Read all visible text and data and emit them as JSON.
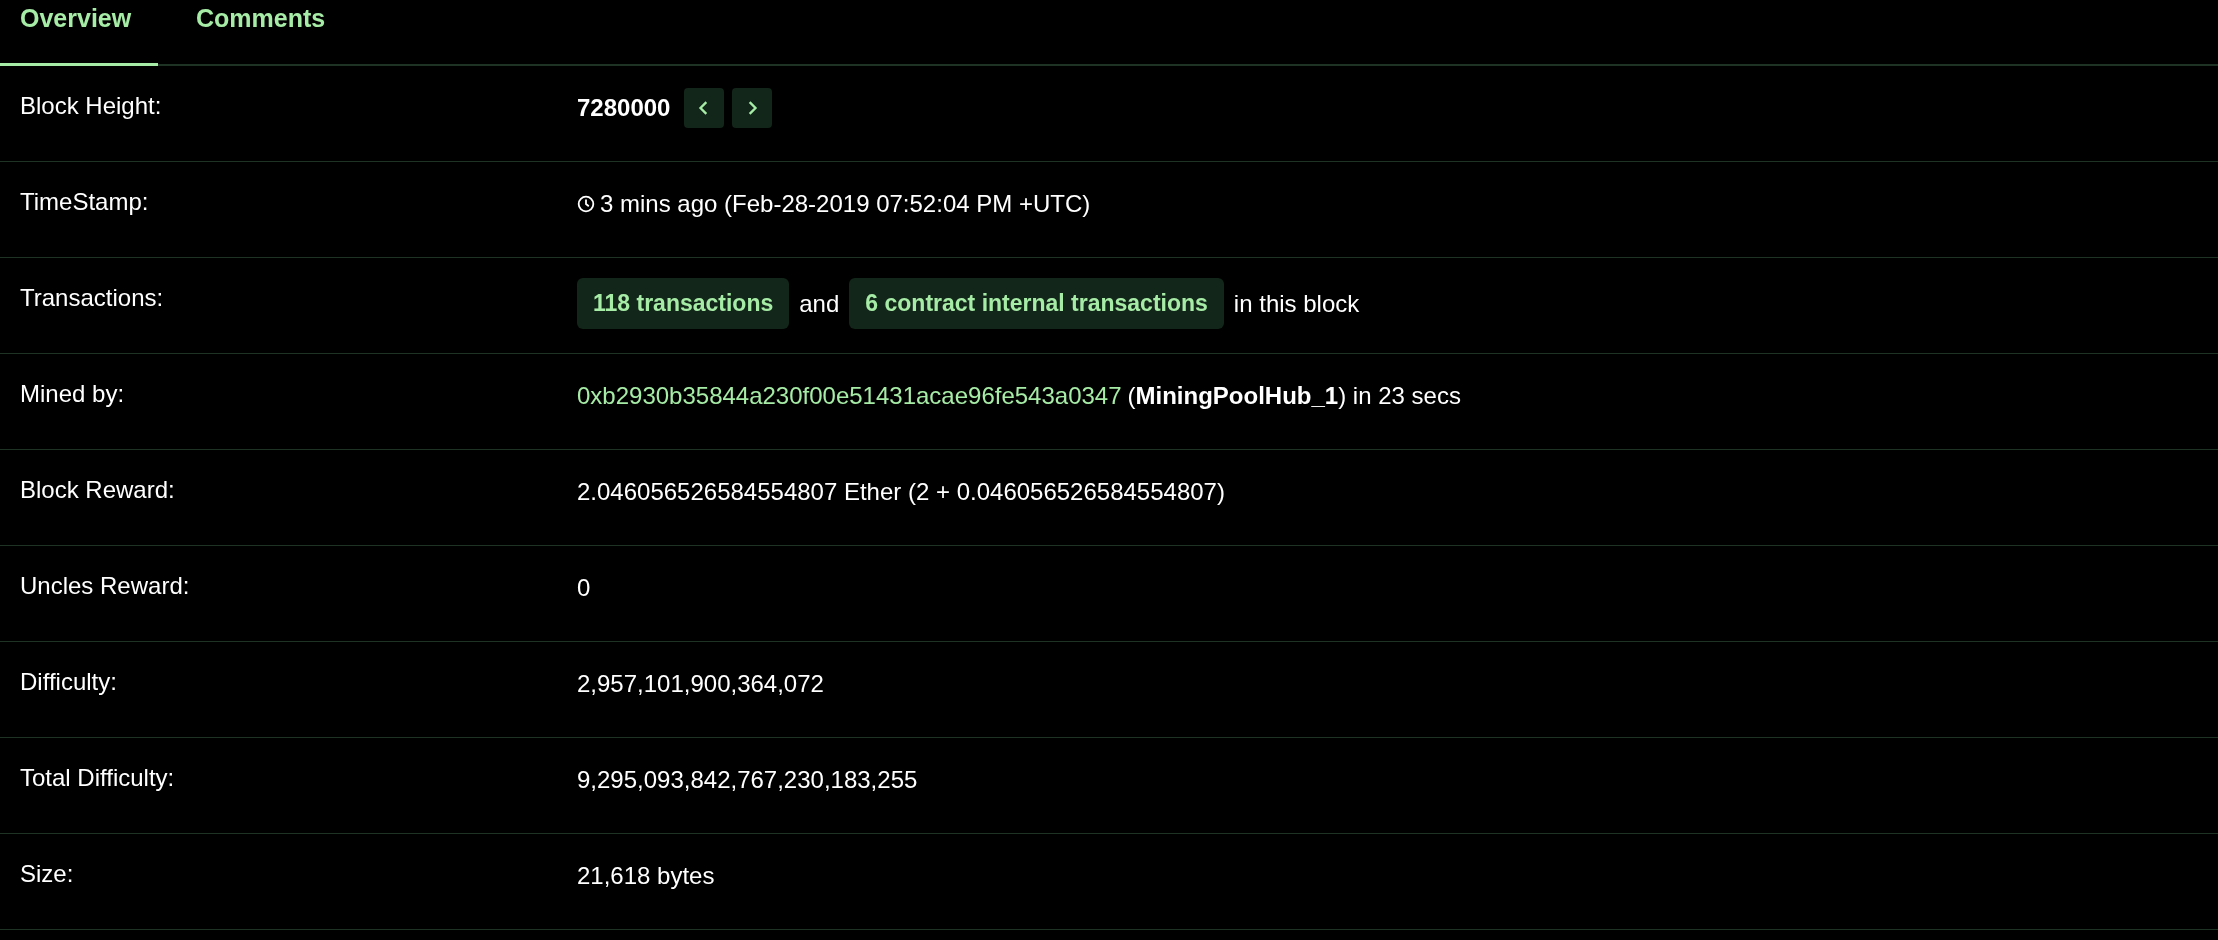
{
  "tabs": [
    {
      "label": "Overview",
      "selected": true
    },
    {
      "label": "Comments",
      "selected": false
    }
  ],
  "rows": [
    {
      "kind": "height",
      "label": "Block Height:",
      "value": "7280000"
    },
    {
      "kind": "timestamp",
      "label": "TimeStamp:",
      "value": "3 mins ago (Feb-28-2019 07:52:04 PM +UTC)"
    },
    {
      "kind": "transactions",
      "label": "Transactions:",
      "badge_1": "118 transactions",
      "joiner": "and",
      "badge_2": "6 contract internal transactions",
      "suffix": "in this block"
    },
    {
      "kind": "miner",
      "label": "Mined by:",
      "address": "0xb2930b35844a230f00e51431acae96fe543a0347",
      "suffix": "(**MiningPoolHub_1**) in 23 secs"
    },
    {
      "kind": "plain",
      "label": "Block Reward:",
      "value": "2.046056526584554807 Ether (2 + 0.046056526584554807)"
    },
    {
      "kind": "plain",
      "label": "Uncles Reward:",
      "value": "0"
    },
    {
      "kind": "plain",
      "label": "Difficulty:",
      "value": "2,957,101,900,364,072"
    },
    {
      "kind": "plain",
      "label": "Total Difficulty:",
      "value": "9,295,093,842,767,230,183,255"
    },
    {
      "kind": "plain",
      "label": "Size:",
      "value": "21,618 bytes"
    }
  ]
}
